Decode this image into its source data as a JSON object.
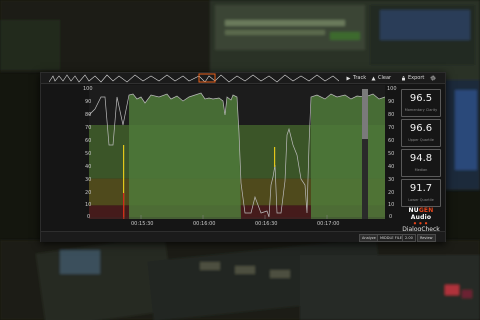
{
  "toolbar": {
    "track_label": "Track",
    "clear_label": "Clear",
    "export_label": "Export"
  },
  "graph": {
    "y_ticks_left": [
      "100",
      "90",
      "80",
      "70",
      "60",
      "50",
      "40",
      "30",
      "20",
      "10",
      "0"
    ],
    "y_ticks_right": [
      "100",
      "90",
      "80",
      "70",
      "60",
      "50",
      "40",
      "30",
      "20",
      "10",
      "0"
    ],
    "x_ticks": [
      "00:15:30",
      "00:16:00",
      "00:16:30",
      "00:17:00"
    ],
    "zone_colors": {
      "green": "#3c5a2a",
      "olive": "#55501c",
      "red": "#4a1c1c"
    }
  },
  "meters": [
    {
      "value": "96.5",
      "label": "Momentary Clarity"
    },
    {
      "value": "96.6",
      "label": "Upper Quartile"
    },
    {
      "value": "94.8",
      "label": "Median"
    },
    {
      "value": "91.7",
      "label": "Lower Quartile"
    }
  ],
  "brand": {
    "nu": "NU",
    "gen": "GEN",
    "audio": " Audio",
    "product": "DialogCheck"
  },
  "bottom": {
    "analyze_label": "Analyze",
    "mode_label": "MIDDLE FILE",
    "value_label": "2.00",
    "review_label": "Review"
  }
}
